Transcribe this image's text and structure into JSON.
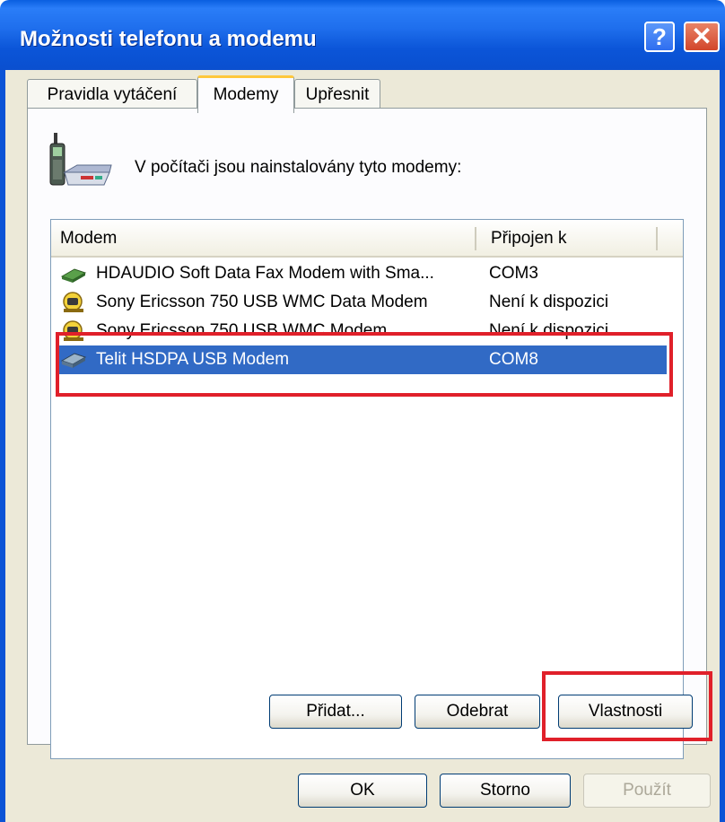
{
  "window": {
    "title": "Možnosti telefonu a modemu"
  },
  "titlebar": {
    "help_glyph": "?",
    "close_glyph": "✕"
  },
  "tabs": [
    {
      "label": "Pravidla vytáčení",
      "active": false
    },
    {
      "label": "Modemy",
      "active": true
    },
    {
      "label": "Upřesnit",
      "active": false
    }
  ],
  "intro_text": "V počítači jsou nainstalovány tyto modemy:",
  "table": {
    "headers": [
      "Modem",
      "Připojen k"
    ],
    "rows": [
      {
        "modem": "HDAUDIO Soft Data Fax Modem with Sma...",
        "port": "COM3",
        "icon": "modem-icon"
      },
      {
        "modem": "Sony Ericsson 750 USB WMC Data Modem",
        "port": "Není k dispozici",
        "icon": "phone-modem-icon"
      },
      {
        "modem": "Sony Ericsson 750 USB WMC Modem",
        "port": "Není k dispozici",
        "icon": "phone-modem-icon"
      },
      {
        "modem": "Telit HSDPA USB Modem",
        "port": "COM8",
        "icon": "modem-icon",
        "selected": true
      }
    ]
  },
  "buttons": {
    "add": "Přidat...",
    "remove": "Odebrat",
    "properties": "Vlastnosti",
    "ok": "OK",
    "cancel": "Storno",
    "apply": "Použít"
  },
  "colors": {
    "selection": "#316ac5",
    "highlight_box": "#e0202a",
    "titlebar": "#0b55d8"
  }
}
